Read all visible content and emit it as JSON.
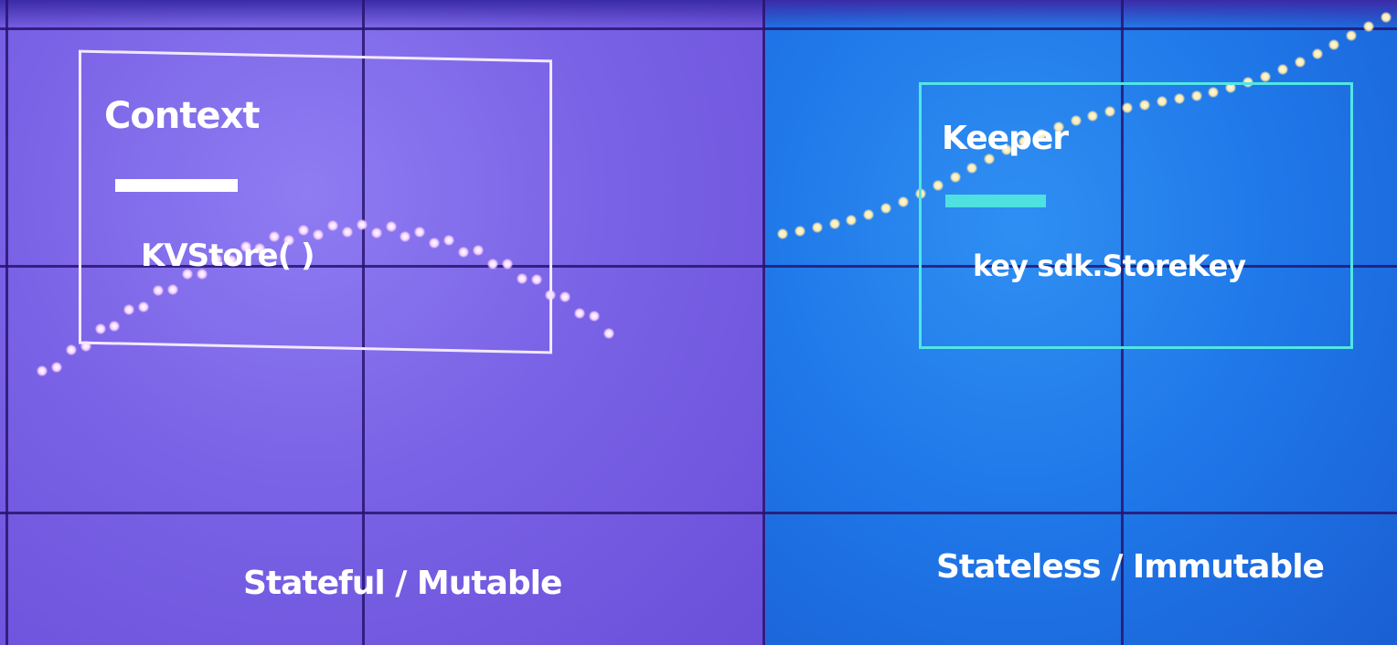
{
  "left_box": {
    "title": "Context",
    "field": "KVStore(   )",
    "caption": "Stateful / Mutable",
    "border_color": "#f3e8ff",
    "bar_color": "#ffffff"
  },
  "right_box": {
    "title": "Keeper",
    "field": "key sdk.StoreKey",
    "caption": "Stateless / Immutable",
    "border_color": "#52e6e2",
    "bar_color": "#4fe0e0"
  },
  "colors": {
    "left_panel": "#7a63e6",
    "right_panel": "#1f77e8",
    "grid": "#281466"
  }
}
